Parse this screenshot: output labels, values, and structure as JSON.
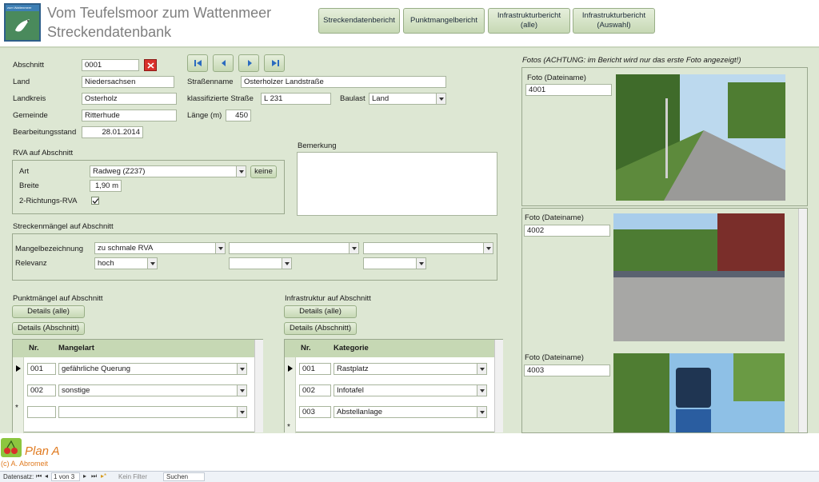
{
  "header": {
    "logo_text": "zum Wattenmeer",
    "title_line1": "Vom Teufelsmoor zum Wattenmeer",
    "title_line2": "Streckendatenbank",
    "buttons": [
      "Streckendatenbericht",
      "Punktmangelbericht",
      "Infrastrukturbericht\n(alle)",
      "Infrastrukturbericht\n(Auswahl)"
    ]
  },
  "form": {
    "abschnitt_label": "Abschnitt",
    "abschnitt_value": "0001",
    "land_label": "Land",
    "land_value": "Niedersachsen",
    "landkreis_label": "Landkreis",
    "landkreis_value": "Osterholz",
    "gemeinde_label": "Gemeinde",
    "gemeinde_value": "Ritterhude",
    "bearbeitungsstand_label": "Bearbeitungsstand",
    "bearbeitungsstand_value": "28.01.2014",
    "strassenname_label": "Straßenname",
    "strassenname_value": "Osterholzer Landstraße",
    "klass_label": "klassifizierte Straße",
    "klass_value": "L 231",
    "baulast_label": "Baulast",
    "baulast_value": "Land",
    "laenge_label": "Länge (m)",
    "laenge_value": "450",
    "bemerkung_label": "Bemerkung"
  },
  "rva": {
    "section_label": "RVA auf Abschnitt",
    "art_label": "Art",
    "art_value": "Radweg (Z237)",
    "keine_label": "keine",
    "breite_label": "Breite",
    "breite_value": "1,90 m",
    "richtung_label": "2-Richtungs-RVA",
    "richtung_checked": true
  },
  "streckenmaengel": {
    "section_label": "Streckenmängel auf Abschnitt",
    "mangel_label": "Mangelbezeichnung",
    "mangel_values": [
      "zu schmale RVA",
      "",
      ""
    ],
    "relevanz_label": "Relevanz",
    "relevanz_values": [
      "hoch",
      "",
      ""
    ]
  },
  "punktmaengel": {
    "section_label": "Punktmängel auf Abschnitt",
    "details_alle": "Details (alle)",
    "details_abschnitt": "Details (Abschnitt)",
    "col_nr": "Nr.",
    "col_art": "Mangelart",
    "rows": [
      {
        "nr": "001",
        "art": "gefährliche Querung"
      },
      {
        "nr": "002",
        "art": "sonstige"
      }
    ]
  },
  "infrastruktur": {
    "section_label": "Infrastruktur auf Abschnitt",
    "details_alle": "Details (alle)",
    "details_abschnitt": "Details (Abschnitt)",
    "col_nr": "Nr.",
    "col_kat": "Kategorie",
    "rows": [
      {
        "nr": "001",
        "kat": "Rastplatz"
      },
      {
        "nr": "002",
        "kat": "Infotafel"
      },
      {
        "nr": "003",
        "kat": "Abstellanlage"
      }
    ]
  },
  "fotos": {
    "header": "Fotos (ACHTUNG: im Bericht wird nur das erste Foto angezeigt!)",
    "items": [
      {
        "label": "Foto (Dateiname)",
        "value": "4001"
      },
      {
        "label": "Foto (Dateiname)",
        "value": "4002"
      },
      {
        "label": "Foto (Dateiname)",
        "value": "4003"
      }
    ]
  },
  "footer": {
    "brand": "Plan A",
    "copyright": "(c) A. Abromeit"
  },
  "statusbar": {
    "datensatz": "Datensatz:",
    "position": "1 von 3",
    "filter": "Kein Filter",
    "suchen": "Suchen"
  },
  "colors": {
    "background": "#dde7d3",
    "button": "#c6d8b4",
    "accent_red": "#d9302a",
    "brand_orange": "#e07a1f"
  }
}
